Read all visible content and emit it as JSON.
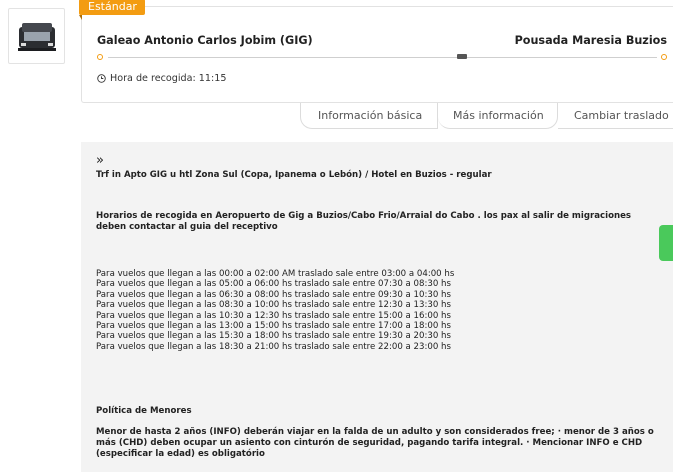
{
  "vehicle": {
    "icon": "van-icon"
  },
  "badge": "Estándar",
  "route": {
    "origin": "Galeao Antonio Carlos Jobim (GIG)",
    "destination": "Pousada Maresia Buzios",
    "pickup": "Hora de recogida: 11:15"
  },
  "tabs": [
    "Información básica",
    "Más información",
    "Cambiar traslado"
  ],
  "content": {
    "arrow": "»",
    "service": "Trf in Apto GIG u htl Zona Sul (Copa, Ipanema o Lebón) / Hotel en Buzios - regular",
    "pickup_note": "Horarios de recogida en Aeropuerto de Gig a Buzios/Cabo Frio/Arraial do Cabo . los pax al salir de migraciones deben contactar al guia del receptivo",
    "schedule": [
      "Para vuelos que llegan a las 00:00 a 02:00 AM traslado sale entre 03:00 a 04:00 hs",
      "Para vuelos que llegan a las 05:00 a 06:00 hs traslado sale entre 07:30 a 08:30 hs",
      "Para vuelos que llegan a las 06:30 a 08:00 hs traslado sale entre 09:30 a 10:30 hs",
      "Para vuelos que llegan a las 08:30 a 10:00 hs traslado sale entre 12:30 a 13:30 hs",
      "Para vuelos que llegan a las 10:30 a 12:30 hs traslado sale entre 15:00 a 16:00 hs",
      "Para vuelos que llegan a las 13:00 a 15:00 hs traslado sale entre 17:00 a 18:00 hs",
      "Para vuelos que llegan a las 15:30 a 18:00 hs traslado sale entre 19:30 a 20:30 hs",
      "Para vuelos que llegan a las 18:30 a 21:00 hs traslado sale entre 22:00 a 23:00 hs"
    ],
    "policy_title": "Política de Menores",
    "policy_text": "Menor de hasta 2 años (INFO) deberán viajar en la falda de un adulto y son considerados free; · menor de 3 años o más (CHD) deben ocupar un asiento con cinturón de seguridad, pagando tarifa integral. · Mencionar INFO e CHD (especificar la edad) es obligatório"
  },
  "colors": {
    "accent": "#f39c12",
    "whatsapp": "#4ac95b"
  }
}
